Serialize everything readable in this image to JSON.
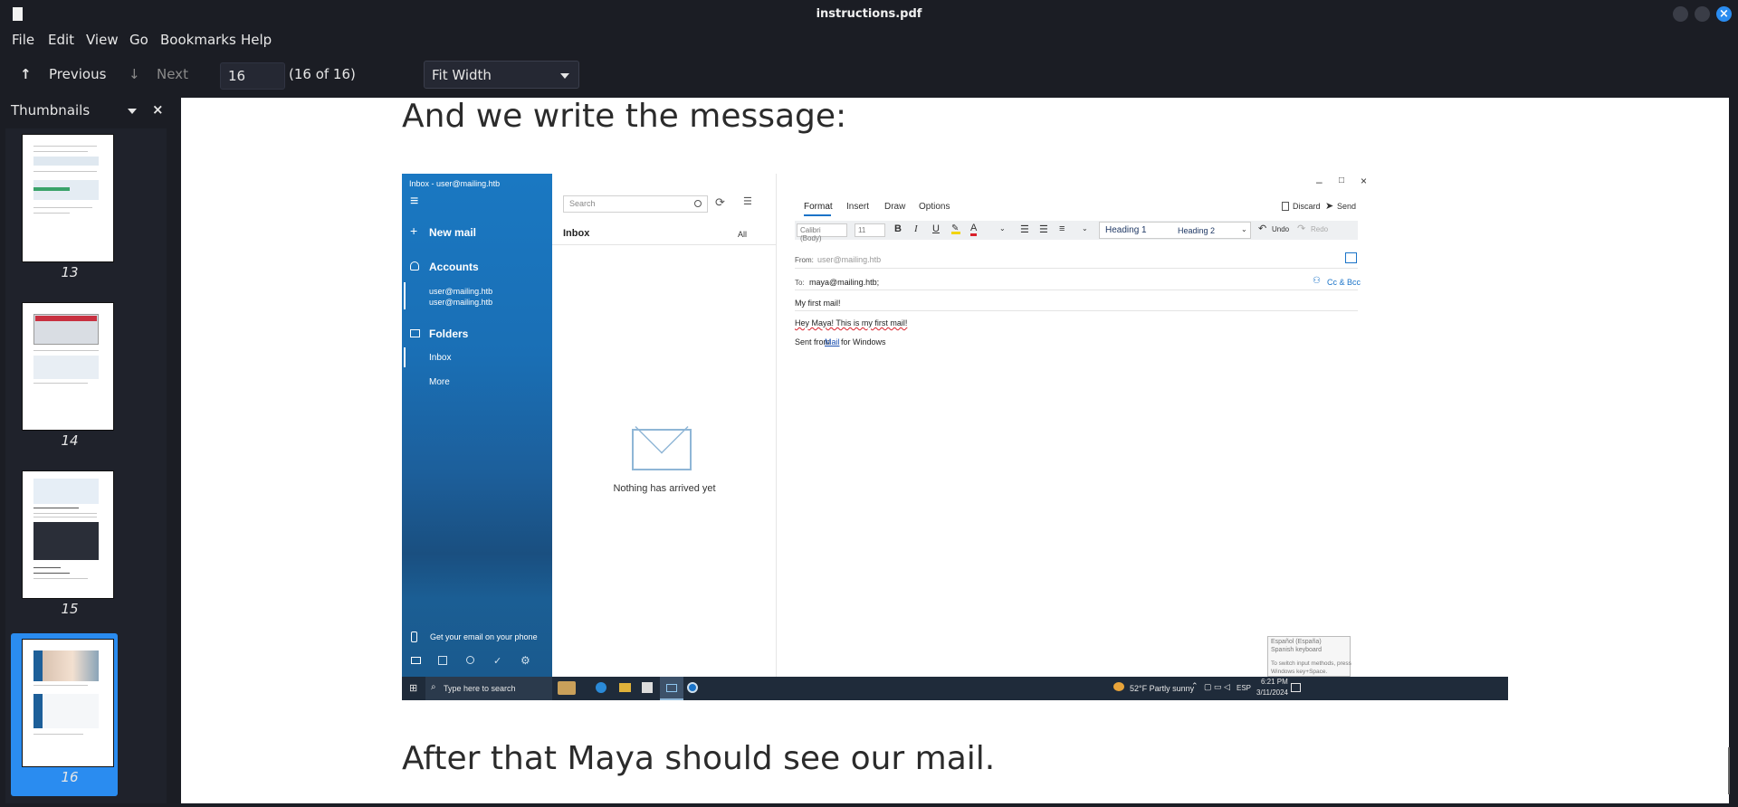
{
  "window": {
    "title": "instructions.pdf",
    "close_glyph": "×"
  },
  "menu": [
    "File",
    "Edit",
    "View",
    "Go",
    "Bookmarks",
    "Help"
  ],
  "toolbar": {
    "previous_label": "Previous",
    "next_label": "Next",
    "page_input_value": "16",
    "page_count": "(16 of 16)",
    "zoom_value": "Fit Width",
    "prev_icon": "↑",
    "next_icon": "↓"
  },
  "sidebar": {
    "title": "Thumbnails",
    "close_glyph": "×",
    "thumbnails": [
      {
        "page": "13",
        "selected": false
      },
      {
        "page": "14",
        "selected": false
      },
      {
        "page": "15",
        "selected": false
      },
      {
        "page": "16",
        "selected": true
      }
    ]
  },
  "document": {
    "heading_top": "And we write the message:",
    "heading_bottom": "After that Maya should see our mail."
  },
  "screenshot": {
    "nav": {
      "window_title": "Inbox - user@mailing.htb",
      "hamburger": "≡",
      "new_mail": "New mail",
      "accounts": "Accounts",
      "account_name": "user@mailing.htb",
      "account_email": "user@mailing.htb",
      "folders": "Folders",
      "inbox": "Inbox",
      "more": "More",
      "phone_promo": "Get your email on your phone"
    },
    "list": {
      "search_placeholder": "Search",
      "inbox_title": "Inbox",
      "filter": "All",
      "empty_text": "Nothing has arrived yet"
    },
    "compose": {
      "tabs": [
        "Format",
        "Insert",
        "Draw",
        "Options"
      ],
      "discard": "Discard",
      "send": "Send",
      "font_name": "Calibri (Body)",
      "font_size": "11",
      "bold": "B",
      "italic": "I",
      "underline": "U",
      "font_color": "A",
      "style_1": "Heading 1",
      "style_2": "Heading 2",
      "undo": "Undo",
      "redo": "Redo",
      "from_label": "From:",
      "from_value": "user@mailing.htb",
      "to_label": "To:",
      "to_value": "maya@mailing.htb;",
      "cc_bcc": "Cc & Bcc",
      "subject": "My first mail!",
      "body": "Hey Maya! This is my first mail!",
      "signature_pre": "Sent from",
      "signature_link": "Mail",
      "signature_post": "for Windows",
      "ime_line1": "Español (España)",
      "ime_line2": "Spanish keyboard",
      "ime_line3": "To switch input methods, press",
      "ime_line4": "Windows key+Space."
    },
    "taskbar": {
      "search": "Type here to search",
      "weather": "52°F  Partly sunny",
      "lang": "ESP",
      "time": "6:21 PM",
      "date": "3/11/2024"
    }
  }
}
